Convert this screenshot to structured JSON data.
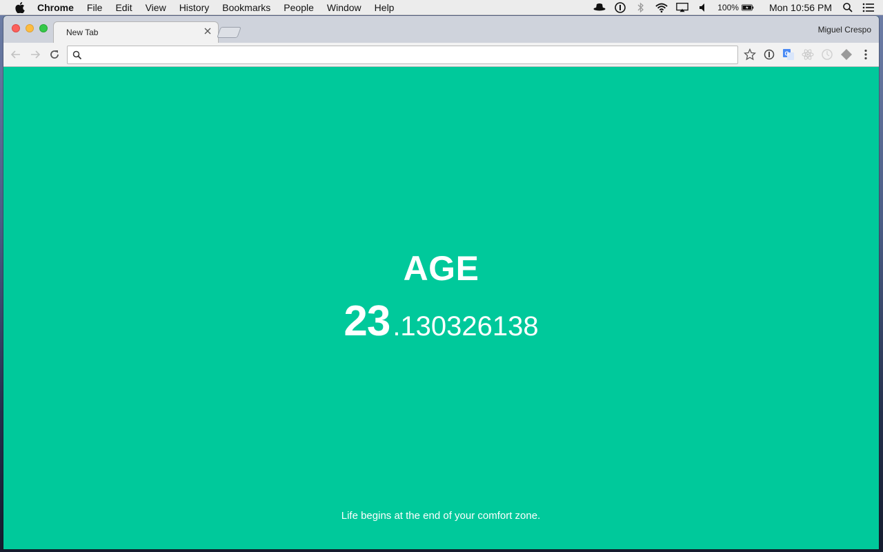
{
  "menubar": {
    "app_name": "Chrome",
    "items": [
      "File",
      "Edit",
      "View",
      "History",
      "Bookmarks",
      "People",
      "Window",
      "Help"
    ],
    "battery": "100%",
    "clock": "Mon 10:56 PM"
  },
  "browser": {
    "tab_title": "New Tab",
    "profile_name": "Miguel Crespo",
    "address_value": "",
    "address_placeholder": ""
  },
  "page": {
    "background": "#00c99b",
    "age_label": "AGE",
    "age_integer": "23",
    "age_fraction": ".130326138",
    "quote": "Life begins at the end of your comfort zone."
  }
}
